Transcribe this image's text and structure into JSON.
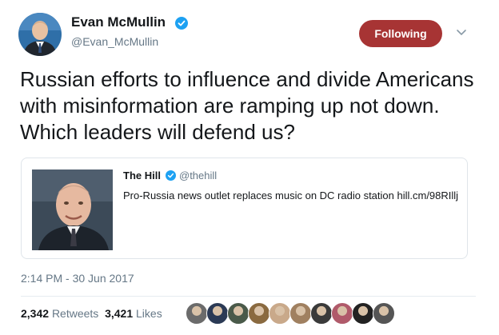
{
  "author": {
    "name": "Evan McMullin",
    "handle": "@Evan_McMullin",
    "verified": true,
    "avatar_icon": "profile-photo-icon"
  },
  "follow_button": {
    "label": "Following",
    "color": "#a73434"
  },
  "menu_caret_icon": "chevron-down-icon",
  "tweet": {
    "text": "Russian efforts to influence and divide Americans with misinformation are ramping up not down. Which leaders will defend us?"
  },
  "quoted": {
    "name": "The Hill",
    "handle": "@thehill",
    "verified": true,
    "text": "Pro-Russia news outlet replaces music on DC radio station hill.cm/98RIllj"
  },
  "timestamp": "2:14 PM - 30 Jun 2017",
  "stats": {
    "retweets_count": "2,342",
    "retweets_label": "Retweets",
    "likes_count": "3,421",
    "likes_label": "Likes"
  },
  "colors": {
    "verified": "#1da1f2",
    "muted_text": "#657786",
    "text": "#14171a"
  },
  "likers": [
    {
      "name": "liker-avatar-1",
      "color": "#6b6b6b"
    },
    {
      "name": "liker-avatar-2",
      "color": "#2b3a55"
    },
    {
      "name": "liker-avatar-3",
      "color": "#4a5a4a"
    },
    {
      "name": "liker-avatar-4",
      "color": "#8a6a40"
    },
    {
      "name": "liker-avatar-5",
      "color": "#c9a98a"
    },
    {
      "name": "liker-avatar-6",
      "color": "#a08060"
    },
    {
      "name": "liker-avatar-7",
      "color": "#3a3a3a"
    },
    {
      "name": "liker-avatar-8",
      "color": "#b05a6a"
    },
    {
      "name": "liker-avatar-9",
      "color": "#222222"
    },
    {
      "name": "liker-avatar-10",
      "color": "#555555"
    }
  ]
}
